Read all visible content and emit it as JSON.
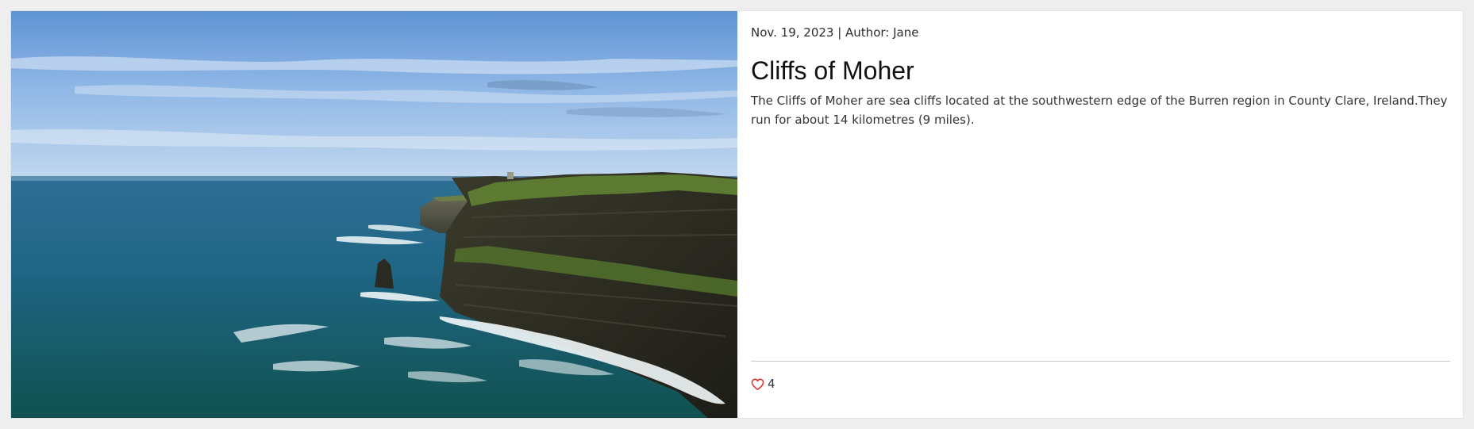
{
  "post": {
    "meta": "Nov. 19, 2023 | Author: Jane",
    "title": "Cliffs of Moher",
    "description": "The Cliffs of Moher are sea cliffs located at the southwestern edge of the Burren region in County Clare, Ireland.They run for about 14 kilometres (9 miles).",
    "likes_count": "4",
    "like_icon": "heart-outline-icon",
    "image_subject": "cliffs-photo"
  },
  "colors": {
    "page_background": "#efeeee",
    "card_background": "#ffffff",
    "heart": "#e0302b",
    "divider": "#c9c9c9"
  }
}
